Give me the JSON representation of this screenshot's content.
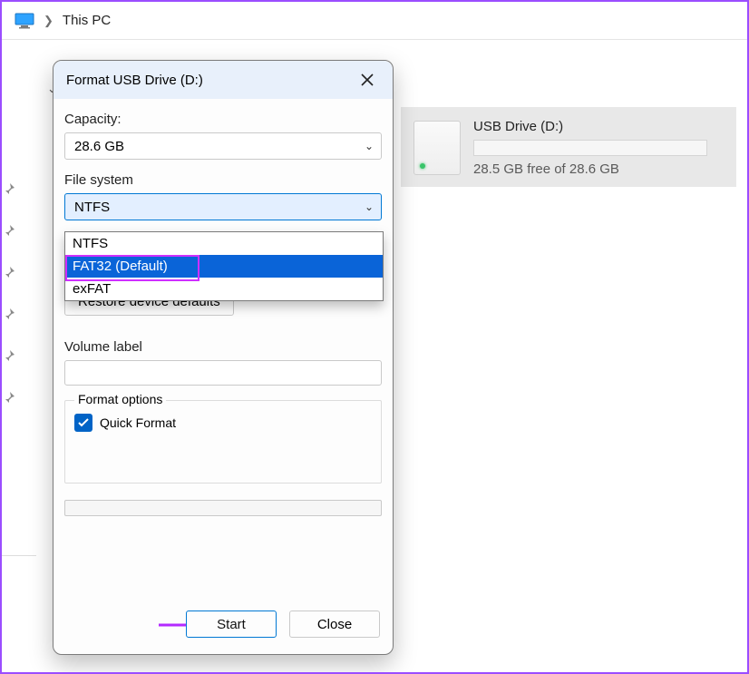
{
  "breadcrumb": {
    "location": "This PC"
  },
  "drive": {
    "name": "USB Drive (D:)",
    "free_text": "28.5 GB free of 28.6 GB"
  },
  "dialog": {
    "title": "Format USB Drive (D:)",
    "capacity_label": "Capacity:",
    "capacity_value": "28.6 GB",
    "filesystem_label": "File system",
    "filesystem_value": "NTFS",
    "dropdown": {
      "opt0": "NTFS",
      "opt1": "FAT32 (Default)",
      "opt2": "exFAT"
    },
    "restore_label": "Restore device defaults",
    "volume_label": "Volume label",
    "volume_value": "",
    "format_options_legend": "Format options",
    "quick_format_label": "Quick Format",
    "quick_format_checked": true,
    "start_label": "Start",
    "close_label": "Close"
  },
  "colors": {
    "accent": "#0078d4",
    "highlight_purple": "#9b4dff",
    "drive_led": "#39c46a"
  }
}
